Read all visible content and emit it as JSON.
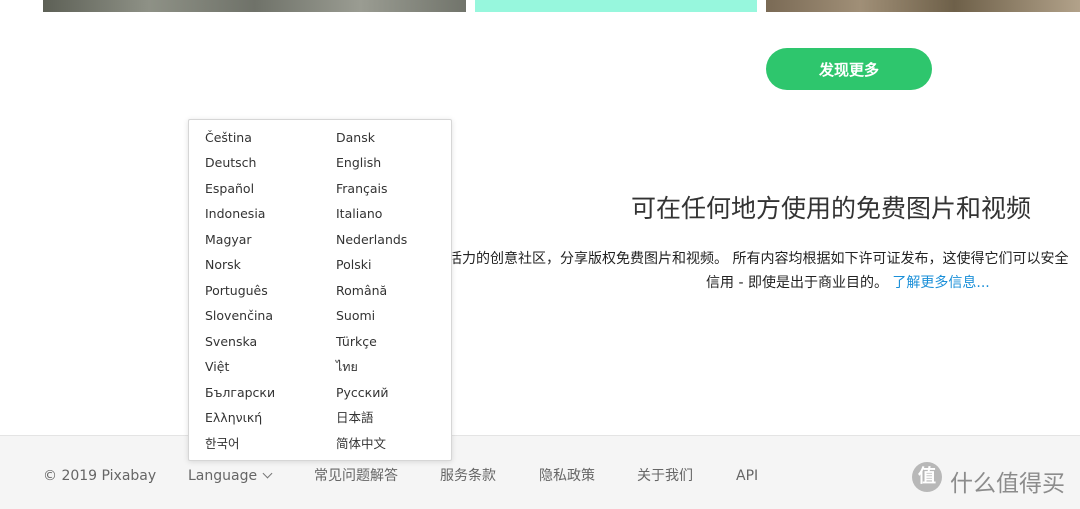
{
  "discover_button": "发现更多",
  "tagline": "可在任何地方使用的免费图片和视频",
  "description": {
    "line1": "活力的创意社区，分享版权免费图片和视频。 所有内容均根据如下许可证发布，这使得它们可以安全",
    "line2_text": "信用 - 即使是出于商业目的。",
    "learn_more": "了解更多信息..."
  },
  "language_menu": {
    "left": [
      "Čeština",
      "Deutsch",
      "Español",
      "Indonesia",
      "Magyar",
      "Norsk",
      "Português",
      "Slovenčina",
      "Svenska",
      "Việt",
      "Български",
      "Ελληνική",
      "한국어"
    ],
    "right": [
      "Dansk",
      "English",
      "Français",
      "Italiano",
      "Nederlands",
      "Polski",
      "Română",
      "Suomi",
      "Türkçe",
      "ไทย",
      "Русский",
      "日本語",
      "简体中文"
    ]
  },
  "footer": {
    "copyright": "© 2019 Pixabay",
    "language": "Language",
    "faq": "常见问题解答",
    "terms": "服务条款",
    "privacy": "隐私政策",
    "about": "关于我们",
    "api": "API"
  },
  "watermark": {
    "logo": "值",
    "text": "什么值得买"
  },
  "colors": {
    "accent_green": "#2ec66d",
    "link_blue": "#1a8fd8",
    "mint_tile": "#97f7dd"
  }
}
